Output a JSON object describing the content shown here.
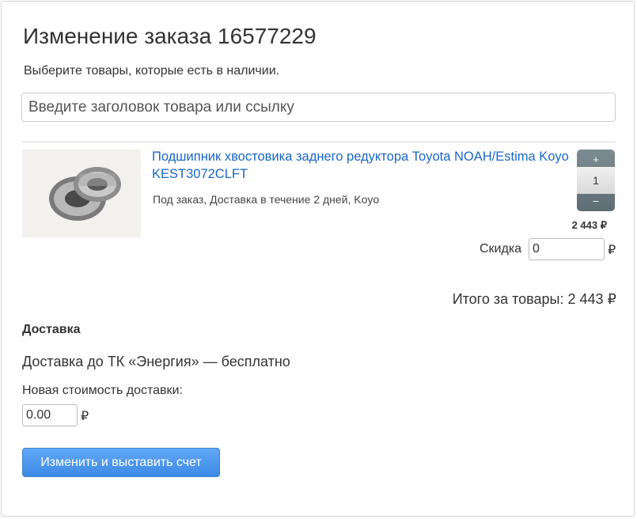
{
  "page": {
    "title": "Изменение заказа 16577229",
    "subtitle": "Выберите товары, которые есть в наличии."
  },
  "search": {
    "placeholder": "Введите заголовок товара или ссылку",
    "value": ""
  },
  "product": {
    "name": "Подшипник хвостовика заднего редуктора Toyota NOAH/Estima Koyo KEST3072CLFT",
    "meta": "Под заказ, Доставка в течение 2 дней, Koyo",
    "quantity": "1",
    "plus_label": "+",
    "minus_label": "–",
    "price": "2 443 ₽",
    "image_icon": "bearing-photo"
  },
  "discount": {
    "label": "Скидка",
    "value": "0",
    "currency": "₽"
  },
  "total": {
    "text": "Итого за товары: 2 443 ₽"
  },
  "delivery": {
    "heading": "Доставка",
    "text": "Доставка до ТК «Энергия» — бесплатно",
    "new_cost_label": "Новая стоимость доставки:",
    "new_cost_value": "0.00",
    "currency": "₽"
  },
  "actions": {
    "submit_label": "Изменить и выставить счет"
  },
  "colors": {
    "link": "#1a66c7",
    "button": "#4a95ec",
    "stepper": "#6f7d84"
  }
}
